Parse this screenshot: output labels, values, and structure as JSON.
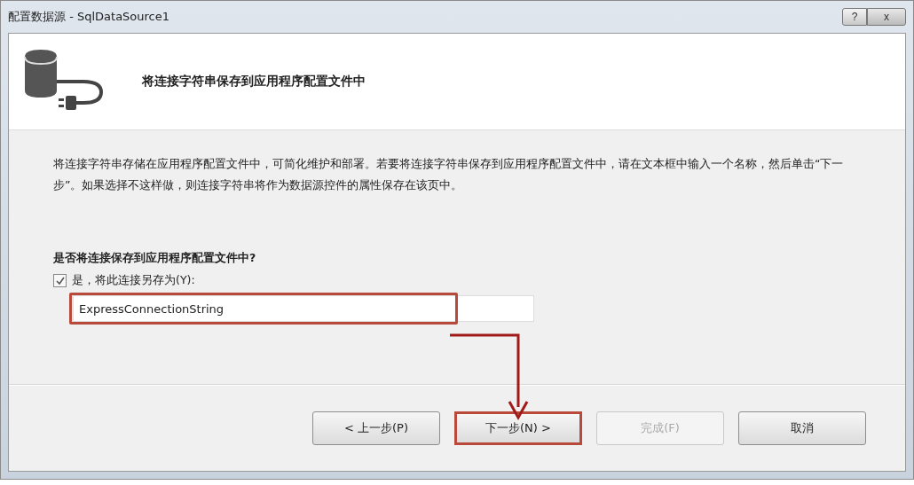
{
  "window": {
    "title": "配置数据源 - SqlDataSource1"
  },
  "title_buttons": [
    {
      "kind": "help",
      "label": "?"
    },
    {
      "kind": "close",
      "label": "x"
    }
  ],
  "header": {
    "title": "将连接字符串保存到应用程序配置文件中"
  },
  "description": "将连接字符串存储在应用程序配置文件中，可简化维护和部署。若要将连接字符串保存到应用程序配置文件中，请在文本框中输入一个名称，然后单击“下一步”。如果选择不这样做，则连接字符串将作为数据源控件的属性保存在该页中。",
  "question": "是否将连接保存到应用程序配置文件中?",
  "save_option": {
    "label": "是，将此连接另存为(Y):",
    "checked": true
  },
  "name_field": {
    "value": "ExpressConnectionString",
    "highlighted": true
  },
  "buttons": [
    {
      "label": "< 上一步(P)",
      "disabled": false,
      "highlighted": false
    },
    {
      "label": "下一步(N) >",
      "disabled": false,
      "highlighted": true
    },
    {
      "label": "完成(F)",
      "disabled": true,
      "highlighted": false
    },
    {
      "label": "取消",
      "disabled": false,
      "highlighted": false
    }
  ]
}
